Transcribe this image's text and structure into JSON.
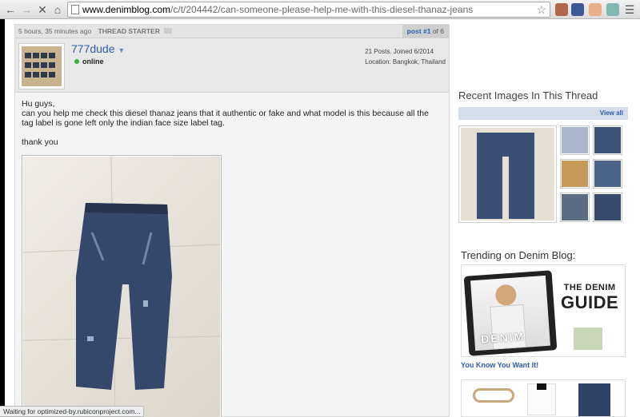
{
  "browser": {
    "url_host": "www.denimblog.com",
    "url_path": "/c/t/204442/can-someone-please-help-me-with-this-diesel-thanaz-jeans",
    "back_icon": "arrow-left-icon",
    "forward_icon": "arrow-right-icon",
    "stop_icon": "close-icon",
    "home_icon": "home-icon",
    "menu_icon": "hamburger-icon"
  },
  "post": {
    "time": "5 hours, 35 minutes ago",
    "starter_label": "THREAD STARTER",
    "post_word": "post #1",
    "post_of": "of 6",
    "username": "777dude",
    "status": "online",
    "posts_joined": "21 Posts. Joined 6/2014",
    "location": "Location: Bangkok, Thailand",
    "greeting": "Hu guys,",
    "body": "can you help me check this diesel thanaz jeans that it authentic or fake and what model is this because all the tag label is gone left only the indian face size label tag.",
    "signoff": "thank you"
  },
  "sidebar": {
    "recent_title": "Recent Images In This Thread",
    "view_all": "View all",
    "trending_title": "Trending on Denim Blog:",
    "ad_line1": "THE DENIM",
    "ad_line2": "GUIDE",
    "tablet_text": "DENIM",
    "ad_caption": "You Know You Want It!"
  },
  "status_bar": "Waiting for optimized-by.rubiconproject.com...",
  "colors": {
    "link": "#2a5db0",
    "online": "#3bb03b",
    "denim": "#33486a"
  }
}
